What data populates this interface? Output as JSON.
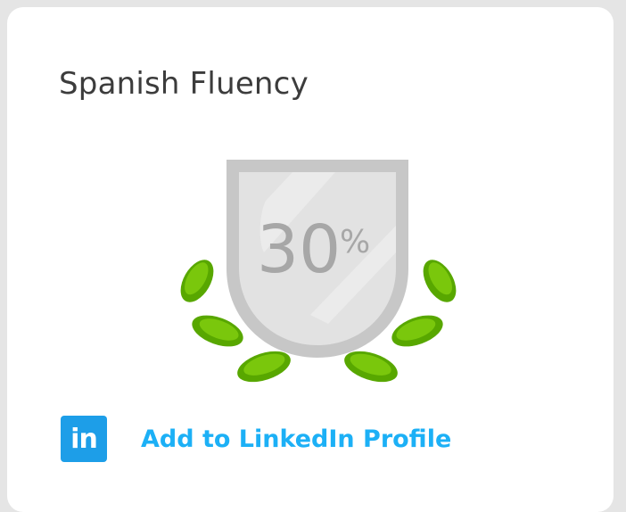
{
  "card": {
    "title": "Spanish Fluency",
    "fluency_percent": "30",
    "percent_symbol": "%",
    "linkedin_icon_text": "in",
    "linkedin_label": "Add to LinkedIn Profile"
  },
  "colors": {
    "shield_fill": "#e2e2e2",
    "shield_border": "#c7c7c7",
    "leaf_outer": "#58a700",
    "leaf_inner": "#7ac70c",
    "link_blue": "#1cb0f6",
    "linkedin_blue": "#1d9ee8"
  },
  "icons": {
    "badge": "shield-with-laurel-icon",
    "linkedin": "linkedin-icon"
  }
}
